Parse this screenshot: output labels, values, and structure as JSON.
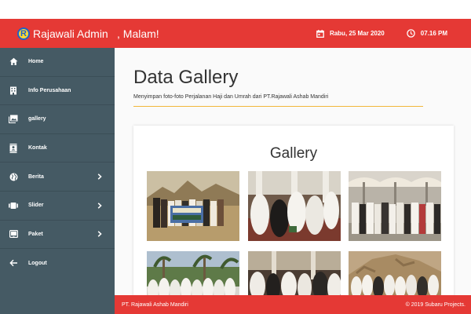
{
  "header": {
    "brand_name": "Rajawali Admin",
    "brand_logo_letter": "R",
    "greeting": ", Malam!",
    "date": "Rabu, 25 Mar 2020",
    "time": "07.16 PM",
    "accent_color": "#e53935"
  },
  "sidebar": {
    "background_color": "#455a64",
    "items": [
      {
        "label": "Home",
        "icon": "home-icon",
        "has_submenu": false
      },
      {
        "label": "Info Perusahaan",
        "icon": "building-icon",
        "has_submenu": false
      },
      {
        "label": "gallery",
        "icon": "photo-library-icon",
        "has_submenu": false
      },
      {
        "label": "Kontak",
        "icon": "contact-book-icon",
        "has_submenu": false
      },
      {
        "label": "Berita",
        "icon": "globe-icon",
        "has_submenu": true
      },
      {
        "label": "Slider",
        "icon": "slides-icon",
        "has_submenu": true
      },
      {
        "label": "Paket",
        "icon": "tablet-icon",
        "has_submenu": true
      },
      {
        "label": "Logout",
        "icon": "arrow-left-icon",
        "has_submenu": false
      }
    ]
  },
  "main": {
    "title": "Data Gallery",
    "subtitle": "Menyimpan foto-foto Perjalanan Haji dan Umrah dari PT.Rajawali Ashab Mandiri",
    "card_title": "Gallery"
  },
  "footer": {
    "left": "PT. Rajawali Ashab Mandiri",
    "right": "© 2019 Subaru Projects."
  }
}
